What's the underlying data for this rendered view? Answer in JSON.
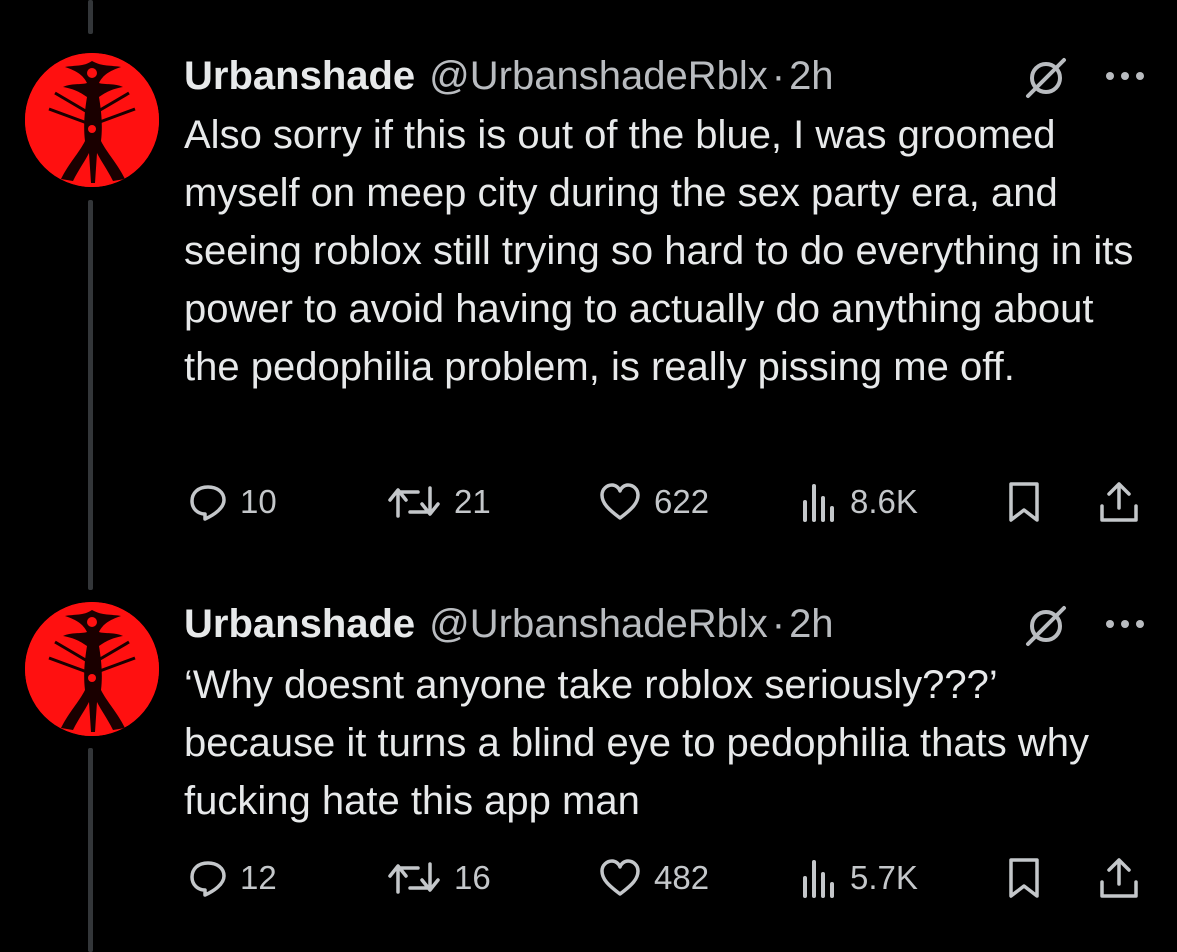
{
  "tweets": [
    {
      "display_name": "Urbanshade",
      "handle": "@UrbanshadeRblx",
      "separator": "·",
      "time": "2h",
      "text": "Also sorry if this is out of the blue, I was groomed myself on meep city during the sex party era, and seeing roblox still trying so hard to do everything in its power to avoid having to actually do anything about the pedophilia problem, is really pissing me off.",
      "stats": {
        "replies": "10",
        "reposts": "21",
        "likes": "622",
        "views": "8.6K"
      }
    },
    {
      "display_name": "Urbanshade",
      "handle": "@UrbanshadeRblx",
      "separator": "·",
      "time": "2h",
      "text": "‘Why doesnt anyone take roblox seriously???’ because it turns a blind eye to pedophilia thats why fucking hate this app man",
      "stats": {
        "replies": "12",
        "reposts": "16",
        "likes": "482",
        "views": "5.7K"
      }
    }
  ],
  "icons": {
    "avatar": "red-figure-avatar",
    "badge": "slashed-circle-icon",
    "more": "more-options-icon",
    "reply": "reply-icon",
    "repost": "repost-icon",
    "like": "heart-icon",
    "views": "views-icon",
    "bookmark": "bookmark-icon",
    "share": "share-icon"
  },
  "colors": {
    "background": "#000000",
    "text": "#e7e9ea",
    "secondary_text": "#b9bcc0",
    "avatar_red": "#ff1010",
    "thread_line": "#333639"
  }
}
